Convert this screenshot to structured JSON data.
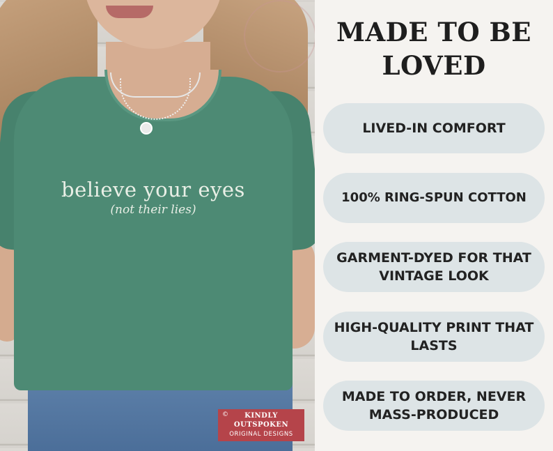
{
  "shirt": {
    "main_text": "believe your eyes",
    "sub_text": "(not their lies)",
    "color": "#4d8a74"
  },
  "brand": {
    "copyright": "©",
    "line1": "KINDLY",
    "line2": "OUTSPOKEN",
    "line3": "ORIGINAL DESIGNS",
    "color": "#b5444a"
  },
  "panel": {
    "headline": "MADE TO BE LOVED",
    "features": [
      "LIVED-IN COMFORT",
      "100% RING-SPUN COTTON",
      "GARMENT-DYED FOR THAT VINTAGE LOOK",
      "HIGH-QUALITY PRINT THAT LASTS",
      "MADE TO ORDER, NEVER MASS-PRODUCED"
    ],
    "pill_color": "#dde4e6"
  }
}
